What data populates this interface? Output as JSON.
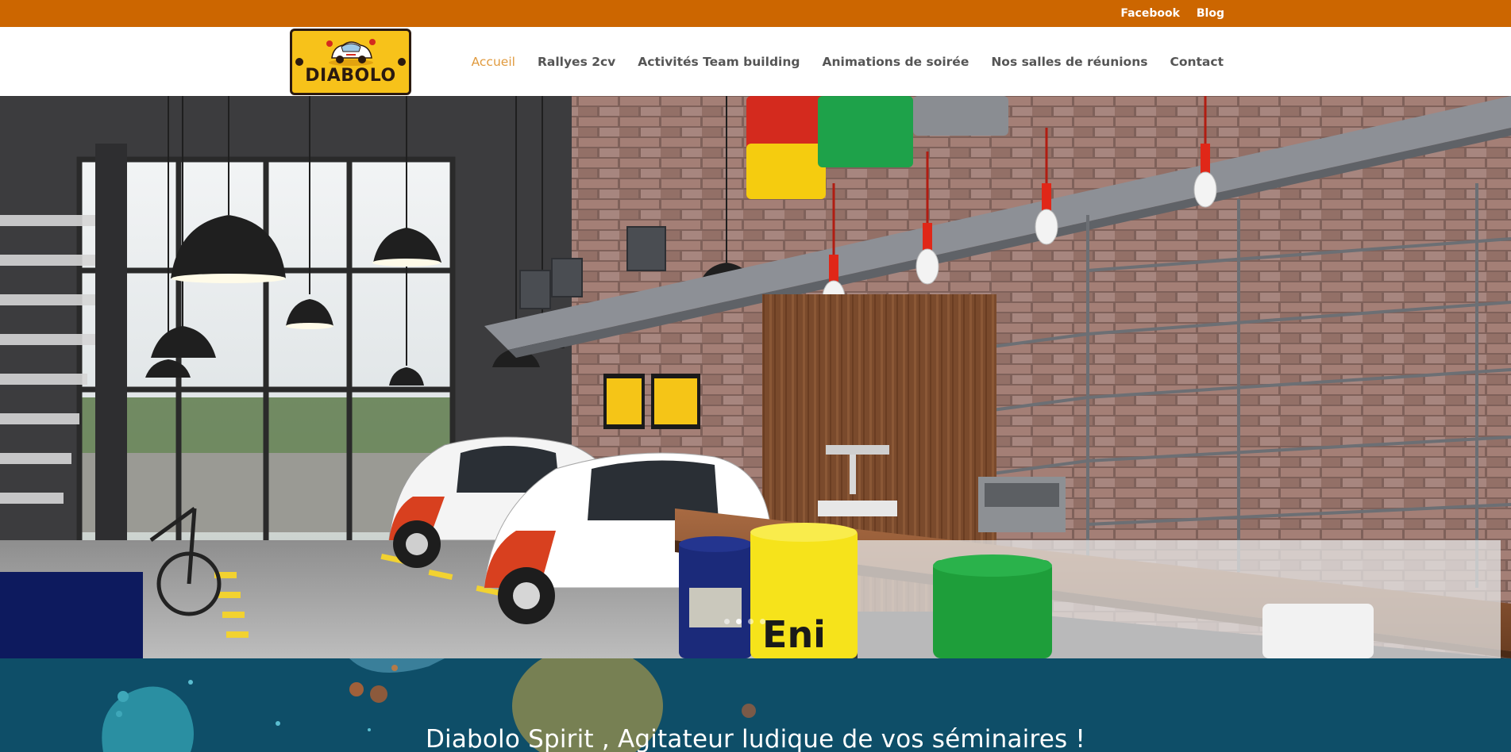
{
  "topbar": {
    "links": [
      "Facebook",
      "Blog"
    ],
    "background": "#cc6600"
  },
  "header": {
    "logo": {
      "name": "DIABOLO",
      "icon": "diabolo-car-logo"
    },
    "nav": {
      "items": [
        "Accueil",
        "Rallyes 2cv",
        "Activités Team building",
        "Animations de soirée",
        "Nos salles de réunions",
        "Contact"
      ],
      "active": "Accueil",
      "active_color": "#e09a3e"
    }
  },
  "hero": {
    "image": "garage-bar-interior-render",
    "slider_dots": {
      "count": 4,
      "active_index": 1
    }
  },
  "intro": {
    "title": "Diabolo Spirit , Agitateur ludique de vos séminaires !",
    "background": "#0e4e68"
  }
}
